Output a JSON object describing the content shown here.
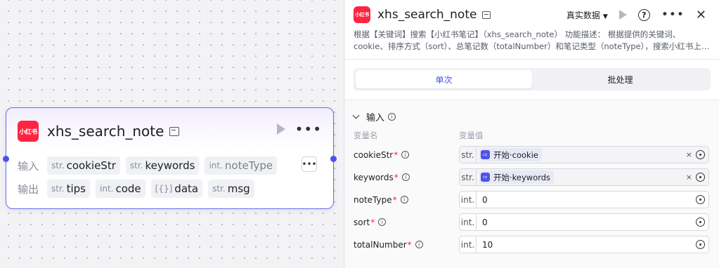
{
  "node": {
    "logo_text": "小红书",
    "title": "xhs_search_note",
    "more": "•••",
    "input_label": "输入",
    "output_label": "输出",
    "inputs": [
      {
        "type": "str.",
        "name": "cookieStr"
      },
      {
        "type": "str.",
        "name": "keywords"
      },
      {
        "type": "int.",
        "name": "noteType"
      }
    ],
    "outputs": [
      {
        "type": "str.",
        "name": "tips"
      },
      {
        "type": "int.",
        "name": "code"
      },
      {
        "type": "[{}]",
        "name": "data"
      },
      {
        "type": "str.",
        "name": "msg"
      }
    ],
    "overflow_button": "•••"
  },
  "panel": {
    "logo_text": "小红书",
    "title": "xhs_search_note",
    "data_mode": "真实数据",
    "caret": "▼",
    "help": "?",
    "more": "•••",
    "close": "✕",
    "description": "根据【关键词】搜索【小红书笔记】（xhs_search_note） 功能描述： 根据提供的关键词、cookie、排序方式（sort）、总笔记数（totalNumber）和笔记类型（noteType），搜索小红书上…",
    "tabs": [
      {
        "label": "单次",
        "active": true
      },
      {
        "label": "批处理",
        "active": false
      }
    ],
    "section_title": "输入",
    "col_name": "变量名",
    "col_value": "变量值",
    "params": [
      {
        "name": "cookieStr",
        "required": "*",
        "type": "str.",
        "ref_source": "开始",
        "ref_sep": " · ",
        "ref_var": "cookie",
        "value": "",
        "clear": "×"
      },
      {
        "name": "keywords",
        "required": "*",
        "type": "str.",
        "ref_source": "开始",
        "ref_sep": " · ",
        "ref_var": "keywords",
        "value": "",
        "clear": "×"
      },
      {
        "name": "noteType",
        "required": "*",
        "type": "int.",
        "ref_source": "",
        "ref_sep": "",
        "ref_var": "",
        "value": "0",
        "clear": ""
      },
      {
        "name": "sort",
        "required": "*",
        "type": "int.",
        "ref_source": "",
        "ref_sep": "",
        "ref_var": "",
        "value": "0",
        "clear": ""
      },
      {
        "name": "totalNumber",
        "required": "*",
        "type": "int.",
        "ref_source": "",
        "ref_sep": "",
        "ref_var": "",
        "value": "10",
        "clear": ""
      }
    ]
  },
  "colors": {
    "accent": "#4d53e8",
    "brand": "#ff2442",
    "required": "#ff2442"
  }
}
